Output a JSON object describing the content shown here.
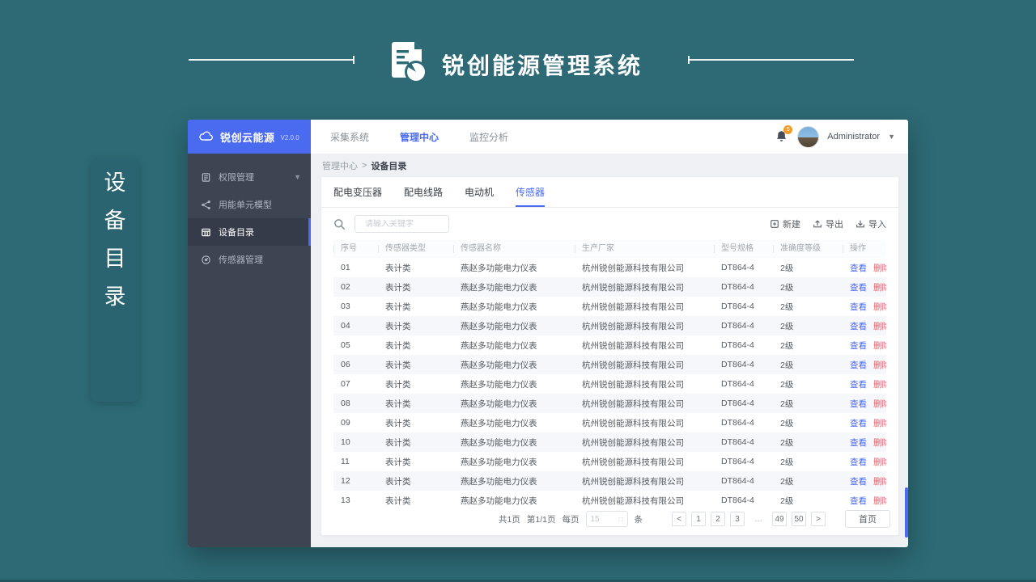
{
  "slide": {
    "title": "锐创能源管理系统",
    "side_label_chars": [
      "设",
      "备",
      "目",
      "录"
    ]
  },
  "app": {
    "sidebar": {
      "brand": "锐创云能源",
      "version": "V2.0.0",
      "items": [
        {
          "key": "permission-management",
          "label": "权限管理",
          "icon": "list-icon",
          "expandable": true,
          "active": false
        },
        {
          "key": "energy-unit-model",
          "label": "用能单元模型",
          "icon": "share-icon",
          "expandable": false,
          "active": false
        },
        {
          "key": "device-directory",
          "label": "设备目录",
          "icon": "grid-icon",
          "expandable": false,
          "active": true
        },
        {
          "key": "sensor-management",
          "label": "传感器管理",
          "icon": "gauge-icon",
          "expandable": false,
          "active": false
        }
      ]
    },
    "topnav": {
      "items": [
        {
          "key": "collection-system",
          "label": "采集系统",
          "active": false
        },
        {
          "key": "management-center",
          "label": "管理中心",
          "active": true
        },
        {
          "key": "monitoring-analysis",
          "label": "监控分析",
          "active": false
        }
      ],
      "notification_badge": "5",
      "user_name": "Administrator"
    },
    "breadcrumb": {
      "parent": "管理中心",
      "separator": ">",
      "current": "设备目录"
    },
    "tabs": [
      {
        "key": "transformer",
        "label": "配电变压器",
        "active": false
      },
      {
        "key": "power-line",
        "label": "配电线路",
        "active": false
      },
      {
        "key": "motor",
        "label": "电动机",
        "active": false
      },
      {
        "key": "sensor",
        "label": "传感器",
        "active": true
      }
    ],
    "search": {
      "placeholder": "请输入关键字"
    },
    "actions": [
      {
        "key": "create",
        "label": "新建",
        "icon": "new-icon"
      },
      {
        "key": "export",
        "label": "导出",
        "icon": "export-icon"
      },
      {
        "key": "import",
        "label": "导入",
        "icon": "import-icon"
      }
    ],
    "table": {
      "columns": [
        "序号",
        "传感器类型",
        "传感器名称",
        "生产厂家",
        "型号规格",
        "准确度等级",
        "操作"
      ],
      "row_actions": {
        "view": "查看",
        "delete": "删除"
      },
      "rows": [
        [
          "01",
          "表计类",
          "燕赵多功能电力仪表",
          "杭州锐创能源科技有限公司",
          "DT864-4",
          "2级"
        ],
        [
          "02",
          "表计类",
          "燕赵多功能电力仪表",
          "杭州锐创能源科技有限公司",
          "DT864-4",
          "2级"
        ],
        [
          "03",
          "表计类",
          "燕赵多功能电力仪表",
          "杭州锐创能源科技有限公司",
          "DT864-4",
          "2级"
        ],
        [
          "04",
          "表计类",
          "燕赵多功能电力仪表",
          "杭州锐创能源科技有限公司",
          "DT864-4",
          "2级"
        ],
        [
          "05",
          "表计类",
          "燕赵多功能电力仪表",
          "杭州锐创能源科技有限公司",
          "DT864-4",
          "2级"
        ],
        [
          "06",
          "表计类",
          "燕赵多功能电力仪表",
          "杭州锐创能源科技有限公司",
          "DT864-4",
          "2级"
        ],
        [
          "07",
          "表计类",
          "燕赵多功能电力仪表",
          "杭州锐创能源科技有限公司",
          "DT864-4",
          "2级"
        ],
        [
          "08",
          "表计类",
          "燕赵多功能电力仪表",
          "杭州锐创能源科技有限公司",
          "DT864-4",
          "2级"
        ],
        [
          "09",
          "表计类",
          "燕赵多功能电力仪表",
          "杭州锐创能源科技有限公司",
          "DT864-4",
          "2级"
        ],
        [
          "10",
          "表计类",
          "燕赵多功能电力仪表",
          "杭州锐创能源科技有限公司",
          "DT864-4",
          "2级"
        ],
        [
          "11",
          "表计类",
          "燕赵多功能电力仪表",
          "杭州锐创能源科技有限公司",
          "DT864-4",
          "2级"
        ],
        [
          "12",
          "表计类",
          "燕赵多功能电力仪表",
          "杭州锐创能源科技有限公司",
          "DT864-4",
          "2级"
        ],
        [
          "13",
          "表计类",
          "燕赵多功能电力仪表",
          "杭州锐创能源科技有限公司",
          "DT864-4",
          "2级"
        ]
      ]
    },
    "pagination": {
      "summary_total": "共1页",
      "summary_page": "第1/1页",
      "per_page_label": "每页",
      "per_page_value": "15",
      "unit": "条",
      "pages": [
        "<",
        "1",
        "2",
        "3",
        "…",
        "49",
        "50",
        ">"
      ],
      "home": "首页"
    }
  },
  "colors": {
    "background_teal": "#2d6a75",
    "accent_blue": "#4a6af0",
    "danger_red": "#e8606e",
    "badge_orange": "#f59a23",
    "sidebar_dark": "#3e4552"
  }
}
